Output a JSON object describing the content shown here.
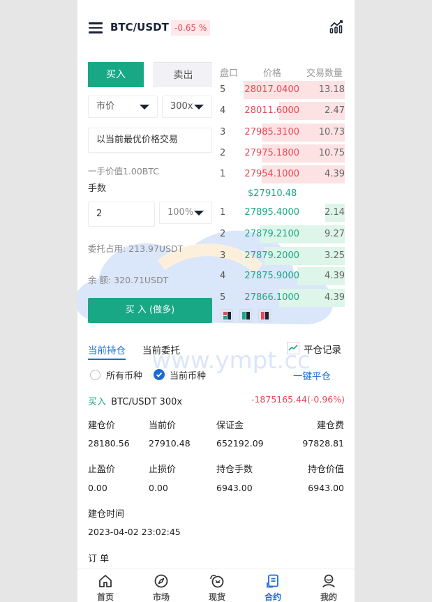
{
  "header": {
    "pair": "BTC/USDT",
    "change": "-0.65 %"
  },
  "trade": {
    "buy_tab": "买入",
    "sell_tab": "卖出",
    "order_type": "市价",
    "leverage": "300x",
    "price_hint": "以当前最优价格交易",
    "lot_value": "一手价值1.00BTC",
    "lots_label": "手数",
    "lots_value": "2",
    "percent": "100%",
    "margin_used": "委托占用: 213.97USDT",
    "balance": "余 额: 320.71USDT",
    "submit": "买 入 (做多)"
  },
  "orderbook": {
    "headers": [
      "盘口",
      "价格",
      "交易数量"
    ],
    "asks": [
      {
        "level": "5",
        "price": "28017.0400",
        "qty": "13.18",
        "depth": 1.0
      },
      {
        "level": "4",
        "price": "28011.6000",
        "qty": "2.47",
        "depth": 0.65
      },
      {
        "level": "3",
        "price": "27985.3100",
        "qty": "10.73",
        "depth": 0.82
      },
      {
        "level": "2",
        "price": "27975.1800",
        "qty": "10.75",
        "depth": 0.82
      },
      {
        "level": "1",
        "price": "27954.1000",
        "qty": "4.39",
        "depth": 0.82
      }
    ],
    "last_price": "$27910.48",
    "bids": [
      {
        "level": "1",
        "price": "27895.4000",
        "qty": "2.14",
        "depth": 0.19
      },
      {
        "level": "2",
        "price": "27879.2100",
        "qty": "9.27",
        "depth": 0.84
      },
      {
        "level": "3",
        "price": "27879.2000",
        "qty": "3.25",
        "depth": 0.79
      },
      {
        "level": "4",
        "price": "27875.9000",
        "qty": "4.39",
        "depth": 0.47
      },
      {
        "level": "5",
        "price": "27866.1000",
        "qty": "4.39",
        "depth": 0.65
      }
    ]
  },
  "positions": {
    "tab_current": "当前持仓",
    "tab_orders": "当前委托",
    "history": "平仓记录",
    "filter_all": "所有币种",
    "filter_current": "当前币种",
    "close_all": "一键平仓",
    "item": {
      "side": "买入",
      "symbol": "BTC/USDT 300x",
      "pnl": "-1875165.44(-0.96%)",
      "open_price_label": "建仓价",
      "open_price": "28180.56",
      "current_price_label": "当前价",
      "current_price": "27910.48",
      "margin_label": "保证金",
      "margin": "652192.09",
      "fee_label": "建仓费",
      "fee": "97828.81",
      "tp_label": "止盈价",
      "tp": "0.00",
      "sl_label": "止损价",
      "sl": "0.00",
      "lots_label": "持仓手数",
      "lots": "6943.00",
      "value_label": "持仓价值",
      "value": "6943.00",
      "time_label": "建仓时间",
      "time": "2023-04-02 23:02:45",
      "order_label": "订 单"
    }
  },
  "nav": [
    {
      "label": "首页",
      "icon": "home-icon"
    },
    {
      "label": "市场",
      "icon": "compass-icon"
    },
    {
      "label": "现货",
      "icon": "spot-icon"
    },
    {
      "label": "合约",
      "icon": "contract-icon"
    },
    {
      "label": "我的",
      "icon": "user-icon"
    }
  ],
  "watermark": "www.ympt.cc",
  "colors": {
    "green": "#18a886",
    "red": "#e84855",
    "blue": "#1b6bd6"
  }
}
